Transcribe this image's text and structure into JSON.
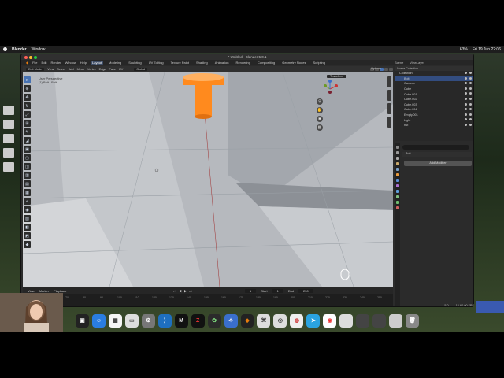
{
  "menubar": {
    "app": "Blender",
    "items": [
      "Window"
    ],
    "clock": "Fri 19 Jun 22:06",
    "battery": "63%"
  },
  "window": {
    "title": "* Untitled - Blender 5.0.1",
    "menus": [
      "File",
      "Edit",
      "Render",
      "Window",
      "Help"
    ],
    "workspaces": [
      "Layout",
      "Modeling",
      "Sculpting",
      "UV Editing",
      "Texture Paint",
      "Shading",
      "Animation",
      "Rendering",
      "Compositing",
      "Geometry Nodes",
      "Scripting"
    ],
    "active_workspace": "Layout",
    "scene_label": "Scene",
    "viewlayer_label": "ViewLayer"
  },
  "viewport_header": {
    "mode": "Edit Mode",
    "menus": [
      "View",
      "Select",
      "Add",
      "Mesh",
      "Vertex",
      "Edge",
      "Face",
      "UV"
    ],
    "orientation": "Global"
  },
  "viewport": {
    "perspective_label": "User Perspective",
    "object_label": "(1) Bolt | Bolt",
    "options_label": "Options",
    "transform_label": "Transform",
    "nav_icons": [
      "zoom-icon",
      "hand-icon",
      "camera-icon",
      "grid-icon"
    ]
  },
  "timeline": {
    "menus": [
      "View",
      "Marker",
      "Playback"
    ],
    "current_frame": "1",
    "start_label": "Start",
    "start": "1",
    "end_label": "End",
    "end": "250",
    "ticks": [
      "50",
      "60",
      "70",
      "80",
      "90",
      "100",
      "110",
      "120",
      "130",
      "140",
      "150",
      "160",
      "170",
      "180",
      "190",
      "200",
      "210",
      "220",
      "230",
      "240",
      "250"
    ]
  },
  "outliner": {
    "header": "Scene Collection",
    "items": [
      {
        "label": "Collection",
        "selected": false
      },
      {
        "label": "Bolt",
        "selected": true
      },
      {
        "label": "Camera",
        "selected": false
      },
      {
        "label": "Cube",
        "selected": false
      },
      {
        "label": "Cube.001",
        "selected": false
      },
      {
        "label": "Cube.002",
        "selected": false
      },
      {
        "label": "Cube.003",
        "selected": false
      },
      {
        "label": "Cube.004",
        "selected": false
      },
      {
        "label": "Empty.001",
        "selected": false
      },
      {
        "label": "Light",
        "selected": false
      },
      {
        "label": "nut",
        "selected": false
      }
    ]
  },
  "properties": {
    "object_name": "Bolt",
    "add_modifier": "Add Modifier"
  },
  "statusbar": {
    "version": "5.0.1",
    "fps": "1 / 60.00 FPS"
  },
  "colors": {
    "selected_object": "#ff8a1e",
    "accent": "#4772b3"
  }
}
